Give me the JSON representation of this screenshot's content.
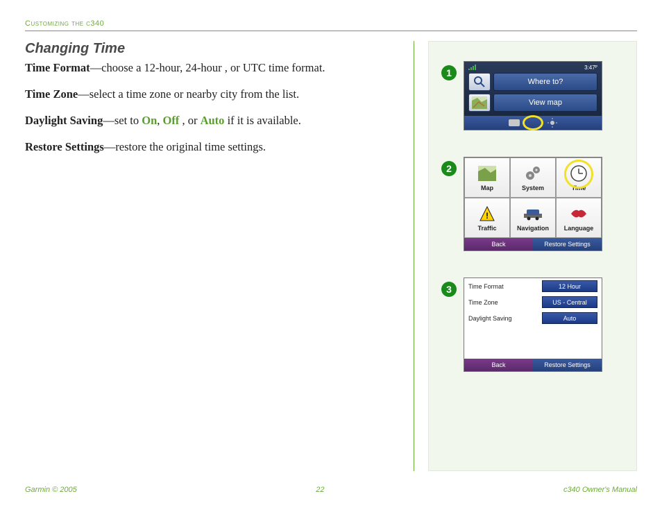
{
  "header": {
    "chapter": "Customizing the c340"
  },
  "section": {
    "title": "Changing Time",
    "items": [
      {
        "label": "Time Format",
        "desc_pre": "—choose a 12-hour, 24-hour , or UTC time format."
      },
      {
        "label": "Time Zone",
        "desc_pre": "—select a time zone or nearby city from the list."
      },
      {
        "label": "Daylight Saving",
        "desc_pre": "—set to ",
        "opt1": "On",
        "sep1": ", ",
        "opt2": "Off",
        "sep2": " , or ",
        "opt3": "Auto",
        "desc_post": " if it is available."
      },
      {
        "label": "Restore Settings",
        "desc_pre": "—restore the original time settings."
      }
    ]
  },
  "steps": {
    "n1": "1",
    "n2": "2",
    "n3": "3"
  },
  "screen1": {
    "time": "3:47ᴾ",
    "where": "Where to?",
    "view": "View map"
  },
  "screen2": {
    "cells": [
      "Map",
      "System",
      "Time",
      "Traffic",
      "Navigation",
      "Language"
    ],
    "back": "Back",
    "restore": "Restore Settings"
  },
  "screen3": {
    "rows": [
      {
        "label": "Time Format",
        "value": "12 Hour"
      },
      {
        "label": "Time Zone",
        "value": "US - Central"
      },
      {
        "label": "Daylight Saving",
        "value": "Auto"
      }
    ],
    "back": "Back",
    "restore": "Restore Settings"
  },
  "footer": {
    "left": "Garmin © 2005",
    "center": "22",
    "right": "c340 Owner's Manual"
  }
}
